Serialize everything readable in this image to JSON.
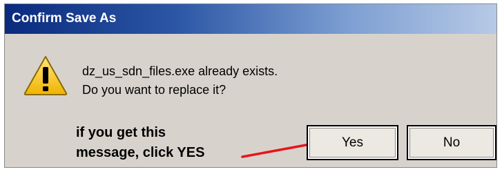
{
  "dialog": {
    "title": "Confirm Save As",
    "message_line1": "dz_us_sdn_files.exe already exists.",
    "message_line2": "Do you want to replace it?",
    "icon": "warning-icon",
    "buttons": {
      "yes_label": "Yes",
      "no_label": "No"
    }
  },
  "annotation": {
    "line1": "if you get this",
    "line2": "message, click YES",
    "arrow_color": "#e8141c"
  },
  "colors": {
    "titlebar_start": "#0a2a7e",
    "titlebar_end": "#b7c9e6",
    "dialog_bg": "#d7d3cc",
    "warning_fill": "#f5c518"
  }
}
